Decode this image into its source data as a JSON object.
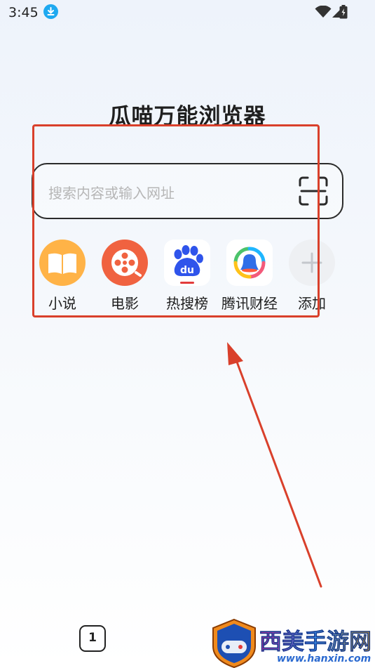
{
  "status_bar": {
    "time": "3:45"
  },
  "app": {
    "title": "瓜喵万能浏览器"
  },
  "search": {
    "placeholder": "搜索内容或输入网址"
  },
  "shortcuts": [
    {
      "label": "小说",
      "icon": "book-icon",
      "color": "#ffb347"
    },
    {
      "label": "电影",
      "icon": "film-reel-icon",
      "color": "#f06240"
    },
    {
      "label": "热搜榜",
      "icon": "baidu-paw-icon",
      "color": "#2f54eb"
    },
    {
      "label": "腾讯财经",
      "icon": "tencent-finance-icon",
      "color": "#1fb6ff"
    },
    {
      "label": "添加",
      "icon": "plus-icon",
      "color": "#e8e8e8"
    }
  ],
  "bottom_bar": {
    "tab_count": "1"
  },
  "watermark": {
    "text": "西美手游网",
    "url": "www.hanxin.com"
  },
  "colors": {
    "highlight": "#d9402b",
    "text": "#1d1d1d"
  }
}
